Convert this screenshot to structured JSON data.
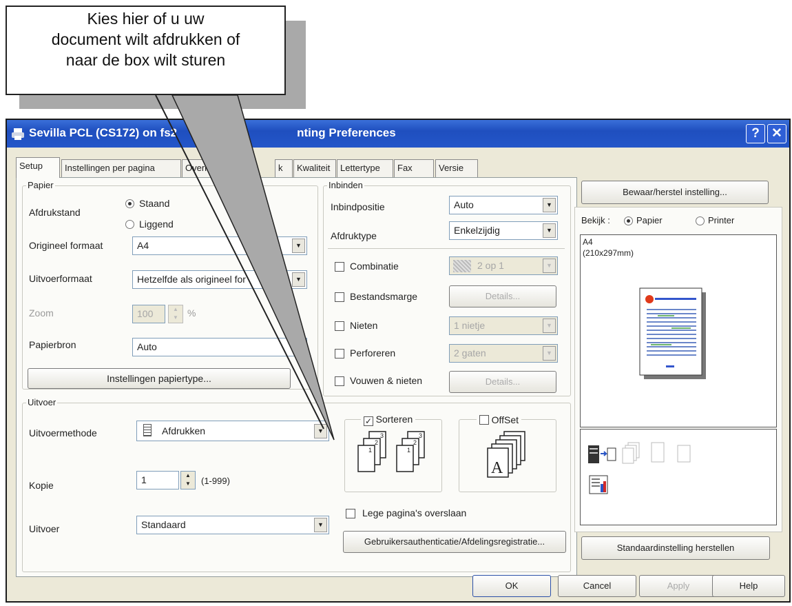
{
  "callout": {
    "lines": [
      "Kies hier of u uw",
      "document wilt afdrukken of",
      "naar de box wilt sturen"
    ]
  },
  "window": {
    "title": "Sevilla PCL (CS172) on fs2",
    "title_tail": "nting Preferences"
  },
  "tabs": [
    "Setup",
    "Instellingen per pagina",
    "Overla",
    "k",
    "Kwaliteit",
    "Lettertype",
    "Fax",
    "Versie"
  ],
  "papier": {
    "group": "Papier",
    "afdrukstand_label": "Afdrukstand",
    "orientation_options": [
      "Staand",
      "Liggend"
    ],
    "orientation_selected": "Staand",
    "origineel_label": "Origineel formaat",
    "origineel_value": "A4",
    "uitvoer_label": "Uitvoerformaat",
    "uitvoer_value": "Hetzelfde als origineel for",
    "zoom_label": "Zoom",
    "zoom_value": "100",
    "zoom_unit": "%",
    "papierbron_label": "Papierbron",
    "papierbron_value": "Auto",
    "papiertype_button": "Instellingen papiertype..."
  },
  "inbinden": {
    "group": "Inbinden",
    "positie_label": "Inbindpositie",
    "positie_value": "Auto",
    "type_label": "Afdruktype",
    "type_value": "Enkelzijdig",
    "combinatie_label": "Combinatie",
    "combinatie_value": "2 op 1",
    "marge_label": "Bestandsmarge",
    "marge_button": "Details...",
    "nieten_label": "Nieten",
    "nieten_value": "1 nietje",
    "perforeren_label": "Perforeren",
    "perforeren_value": "2 gaten",
    "vouwen_label": "Vouwen & nieten",
    "vouwen_button": "Details..."
  },
  "uitvoer": {
    "group": "Uitvoer",
    "methode_label": "Uitvoermethode",
    "methode_value": "Afdrukken",
    "kopie_label": "Kopie",
    "kopie_value": "1",
    "kopie_range": "(1-999)",
    "uitvoer_label": "Uitvoer",
    "uitvoer_value": "Standaard",
    "sorteren_label": "Sorteren",
    "sorteren_checked": true,
    "offset_label": "OffSet",
    "lege_label": "Lege pagina's overslaan",
    "auth_button": "Gebruikersauthenticatie/Afdelingsregistratie..."
  },
  "preview": {
    "save_button": "Bewaar/herstel instelling...",
    "bekijk_label": "Bekijk :",
    "view_options": [
      "Papier",
      "Printer"
    ],
    "view_selected": "Papier",
    "paper_size": "A4",
    "paper_dims": "(210x297mm)",
    "reset_button": "Standaardinstelling herstellen"
  },
  "footer": {
    "ok": "OK",
    "cancel": "Cancel",
    "apply": "Apply",
    "help": "Help"
  },
  "colors": {
    "titlebar": "#2456c9",
    "dialog_bg": "#ece9d8",
    "callout_shadow": "#a9a9a9"
  }
}
